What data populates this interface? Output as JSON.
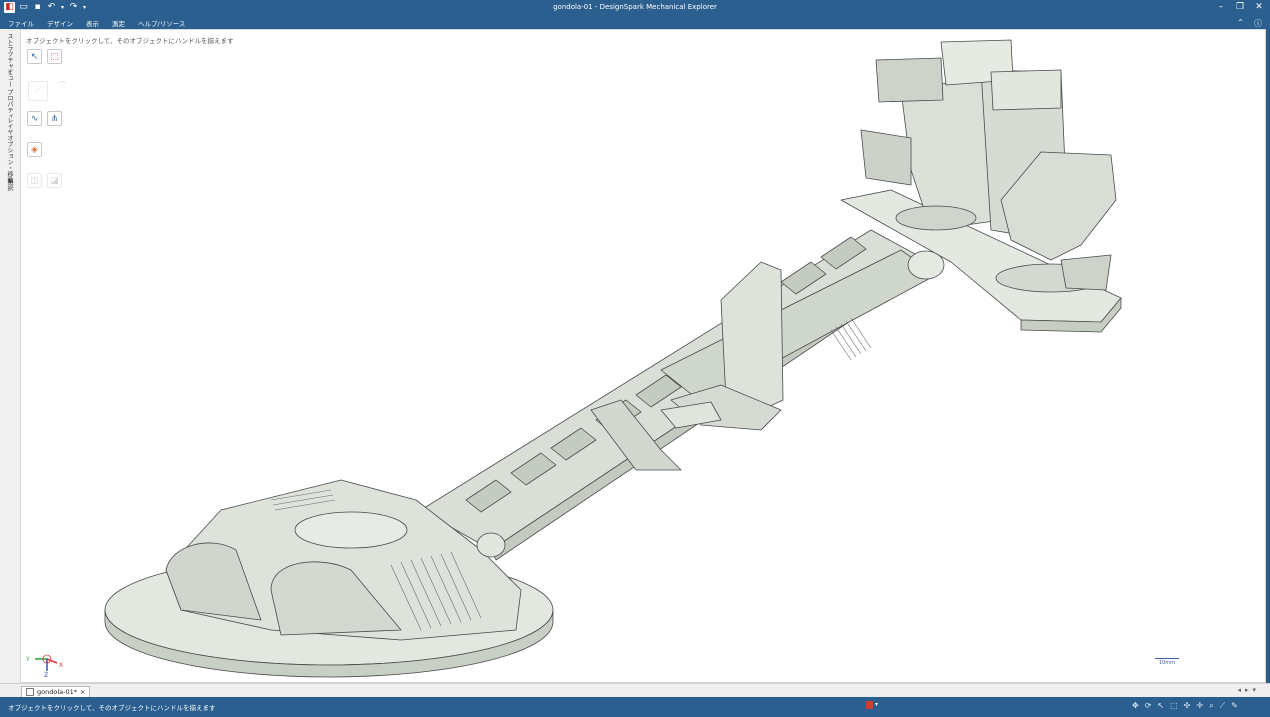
{
  "window": {
    "title": "gondola-01 - DesignSpark Mechanical Explorer"
  },
  "quick_access": [
    {
      "name": "app-logo-icon",
      "glyph": "◧"
    },
    {
      "name": "open-icon",
      "glyph": "▭"
    },
    {
      "name": "save-icon",
      "glyph": "▪"
    },
    {
      "name": "undo-icon",
      "glyph": "↶"
    },
    {
      "name": "redo-icon",
      "glyph": "↷"
    }
  ],
  "menu": {
    "items": [
      "ファイル",
      "デザイン",
      "表示",
      "測定",
      "ヘルプ/リソース"
    ]
  },
  "side_tabs": [
    "ストラクチャー",
    "ビュー",
    "プロパティ",
    "レイヤ",
    "オプション・移動",
    "選択"
  ],
  "viewport": {
    "hint": "オブジェクトをクリックして、そのオブジェクトにハンドルを揃えます",
    "scale_label": "10mm",
    "triad": {
      "y": "Y",
      "x": "X",
      "z": "Z"
    }
  },
  "tools": [
    {
      "name": "select-tool-icon",
      "glyph": "↖",
      "enabled": true
    },
    {
      "name": "select-body-tool-icon",
      "glyph": "⬚",
      "enabled": true
    },
    {
      "name": "sketch-tool-icon",
      "glyph": "⟋",
      "enabled": false
    },
    {
      "name": "pull-tool-icon",
      "glyph": "⌒",
      "enabled": false
    },
    {
      "name": "line-tool-icon",
      "glyph": "∿",
      "enabled": true
    },
    {
      "name": "split-tool-icon",
      "glyph": "⋔",
      "enabled": true
    },
    {
      "name": "material-tool-icon",
      "glyph": "◈",
      "enabled": true
    },
    {
      "name": "move-tool-icon",
      "glyph": "◫",
      "enabled": false
    },
    {
      "name": "combine-tool-icon",
      "glyph": "◪",
      "enabled": false
    }
  ],
  "doc_tab": {
    "label": "gondola-01*",
    "close": "×"
  },
  "status": {
    "message": "オブジェクトをクリックして、そのオブジェクトにハンドルを揃えます"
  },
  "colors": {
    "chrome": "#2a5f8f",
    "model_fill": "#dfe5dd",
    "model_edge": "#4a4a4a"
  }
}
